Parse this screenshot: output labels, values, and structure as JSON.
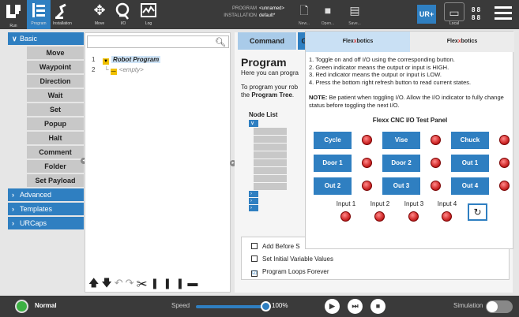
{
  "topbar": {
    "nav": [
      {
        "label": "Run",
        "icon": "run-icon"
      },
      {
        "label": "Program",
        "icon": "program-icon"
      },
      {
        "label": "Installation",
        "icon": "installation-icon"
      },
      {
        "label": "Move",
        "icon": "move-icon"
      },
      {
        "label": "I/O",
        "icon": "io-icon"
      },
      {
        "label": "Log",
        "icon": "log-icon"
      }
    ],
    "program_key": "PROGRAM",
    "program_val": "<unnamed>",
    "installation_key": "INSTALLATION",
    "installation_val": "default*",
    "new_label": "New...",
    "open_label": "Open...",
    "save_label": "Save...",
    "local_label": "Local"
  },
  "toolbox": {
    "basic_label": "Basic",
    "basic_items": [
      "Move",
      "Waypoint",
      "Direction",
      "Wait",
      "Set",
      "Popup",
      "Halt",
      "Comment",
      "Folder",
      "Set Payload"
    ],
    "advanced_label": "Advanced",
    "templates_label": "Templates",
    "urcaps_label": "URCaps"
  },
  "tree": {
    "line1_num": "1",
    "line1_text": "Robot Program",
    "line2_num": "2",
    "line2_text": "<empty>"
  },
  "content": {
    "tab_command": "Command",
    "tab_g": "G",
    "title": "Program",
    "desc1": "Here you can progra",
    "desc2a": "To program your rob",
    "desc2b_prefix": "the ",
    "desc2b_bold": "Program Tree",
    "desc2b_suffix": ".",
    "node_list_label": "Node List",
    "opt1": "Add Before S",
    "opt2": "Set Initial Variable Values",
    "opt3": "Program Loops Forever",
    "opt3_checked": true
  },
  "flex": {
    "tab_a_pre": "Flex",
    "tab_a_x": "x",
    "tab_a_post": "botics",
    "tab_b_pre": "Flex",
    "tab_b_x": "x",
    "tab_b_post": "botics",
    "instr1": "1. Toggle on and off I/O using the corresponding button.",
    "instr2": "2. Green indicator means the output or input is HIGH.",
    "instr3": "3. Red indicator means the output or input is LOW.",
    "instr4": "4. Press the bottom right refresh button to read current states.",
    "note_label": "NOTE:",
    "note_text": " Be patient when toggling I/O. Allow the I/O indicator to fully change status before toggling the next I/O.",
    "panel_title": "Flexx CNC I/O Test Panel",
    "outputs": [
      "Cycle",
      "Vise",
      "Chuck",
      "Door 1",
      "Door 2",
      "Out 1",
      "Out 2",
      "Out 3",
      "Out 4"
    ],
    "inputs": [
      "Input 1",
      "Input 2",
      "Input 3",
      "Input 4"
    ],
    "indicator_color": "#d32f2f"
  },
  "footer": {
    "status": "Normal",
    "speed_label": "Speed",
    "speed_value": "100%",
    "simulation_label": "Simulation"
  },
  "colors": {
    "accent": "#2f7fc1",
    "topbar": "#3a3a3a",
    "status_ok": "#3cb043"
  }
}
